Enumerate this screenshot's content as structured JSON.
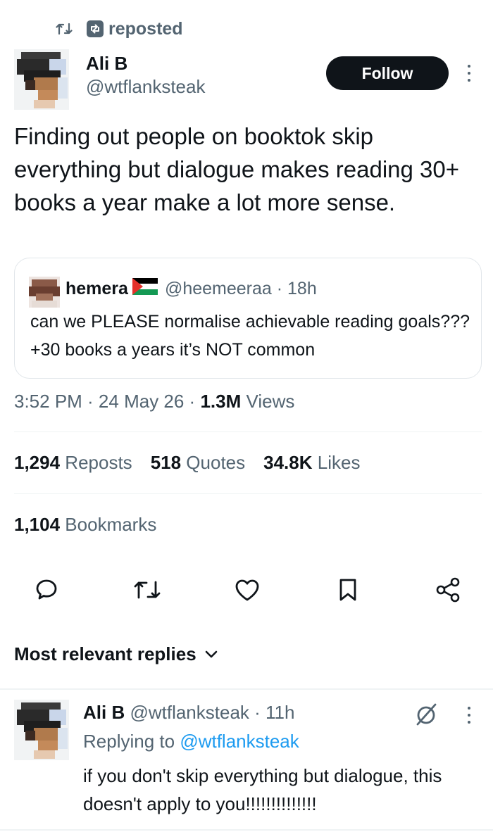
{
  "repost": {
    "label": "reposted",
    "icons": [
      "repost-icon",
      "repost-box-icon"
    ]
  },
  "tweet": {
    "author_name": "Ali B",
    "author_handle": "@wtflanksteak",
    "follow_label": "Follow",
    "text": "Finding out people on booktok skip everything but dialogue makes reading 30+ books a year make a lot more sense.",
    "timestamp": "3:52 PM · 24 May 26 · ",
    "views_count": "1.3M",
    "views_label": " Views"
  },
  "quote": {
    "name": "hemera",
    "handle_time": "@heemeeraa · 18h",
    "text": "can we PLEASE normalise achievable reading goals??? +30 books a years it’s NOT common"
  },
  "stats": {
    "reposts_count": "1,294",
    "reposts_label": " Reposts",
    "quotes_count": "518",
    "quotes_label": " Quotes",
    "likes_count": "34.8K",
    "likes_label": " Likes",
    "bookmarks_count": "1,104",
    "bookmarks_label": " Bookmarks"
  },
  "actions": [
    "reply-icon",
    "repost-icon",
    "like-icon",
    "bookmark-icon",
    "share-icon"
  ],
  "replies": {
    "sort_label": "Most relevant replies",
    "items": [
      {
        "name": "Ali B",
        "handle_time": " @wtflanksteak · 11h",
        "replying_prefix": "Replying to ",
        "replying_handle": "@wtflanksteak",
        "text": "if you don't skip everything but dialogue, this doesn't apply to you!!!!!!!!!!!!!!"
      }
    ]
  },
  "colors": {
    "text_primary": "#0f1419",
    "text_secondary": "#536471",
    "link": "#1d9bf0",
    "follow_bg": "#0f1419",
    "divider": "#eff3f4"
  }
}
